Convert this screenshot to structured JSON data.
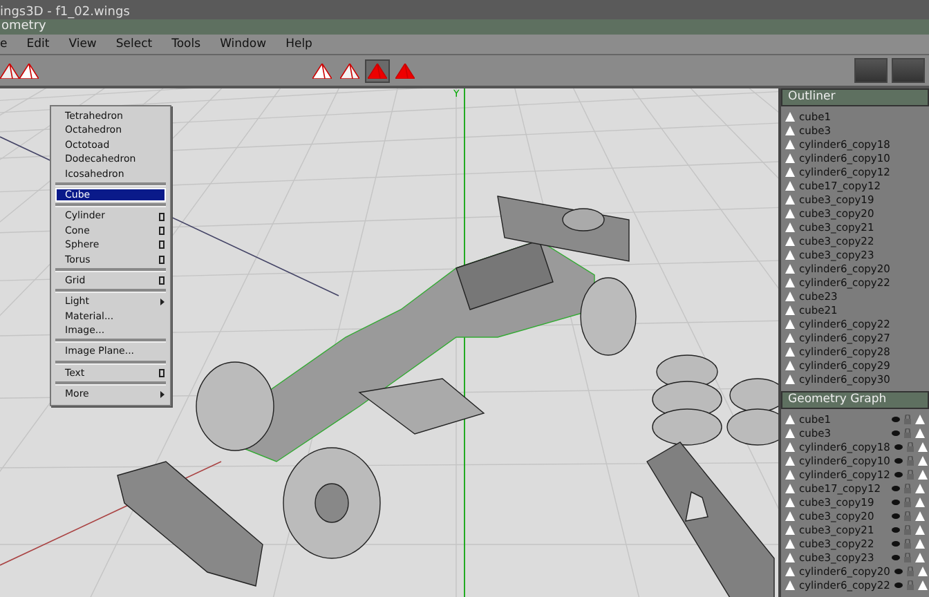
{
  "window": {
    "title": "ings3D - f1_02.wings"
  },
  "geometry_window": {
    "title": "ometry"
  },
  "menubar": [
    "e",
    "Edit",
    "View",
    "Select",
    "Tools",
    "Window",
    "Help"
  ],
  "selection_modes": [
    {
      "kind": "vertex",
      "selected": false
    },
    {
      "kind": "edge",
      "selected": false
    },
    {
      "kind": "face",
      "selected": true
    },
    {
      "kind": "body",
      "selected": false
    }
  ],
  "axis_label": "Y",
  "context_menu": {
    "items": [
      {
        "kind": "item",
        "label": "Tetrahedron",
        "selected": false
      },
      {
        "kind": "item",
        "label": "Octahedron",
        "selected": false
      },
      {
        "kind": "item",
        "label": "Octotoad",
        "selected": false
      },
      {
        "kind": "item",
        "label": "Dodecahedron",
        "selected": false
      },
      {
        "kind": "item",
        "label": "Icosahedron",
        "selected": false
      },
      {
        "kind": "separator"
      },
      {
        "kind": "item",
        "label": "Cube",
        "selected": true
      },
      {
        "kind": "separator"
      },
      {
        "kind": "option",
        "label": "Cylinder",
        "selected": false
      },
      {
        "kind": "option",
        "label": "Cone",
        "selected": false
      },
      {
        "kind": "option",
        "label": "Sphere",
        "selected": false
      },
      {
        "kind": "option",
        "label": "Torus",
        "selected": false
      },
      {
        "kind": "separator"
      },
      {
        "kind": "option",
        "label": "Grid",
        "selected": false
      },
      {
        "kind": "separator"
      },
      {
        "kind": "submenu",
        "label": "Light",
        "selected": false
      },
      {
        "kind": "item",
        "label": "Material...",
        "selected": false
      },
      {
        "kind": "item",
        "label": "Image...",
        "selected": false
      },
      {
        "kind": "separator"
      },
      {
        "kind": "item",
        "label": "Image Plane...",
        "selected": false
      },
      {
        "kind": "separator"
      },
      {
        "kind": "option",
        "label": "Text",
        "selected": false
      },
      {
        "kind": "separator"
      },
      {
        "kind": "submenu",
        "label": "More",
        "selected": false
      }
    ]
  },
  "outliner": {
    "title": "Outliner",
    "items": [
      "cube1",
      "cube3",
      "cylinder6_copy18",
      "cylinder6_copy10",
      "cylinder6_copy12",
      "cube17_copy12",
      "cube3_copy19",
      "cube3_copy20",
      "cube3_copy21",
      "cube3_copy22",
      "cube3_copy23",
      "cylinder6_copy20",
      "cylinder6_copy22",
      "cube23",
      "cube21",
      "cylinder6_copy22",
      "cylinder6_copy27",
      "cylinder6_copy28",
      "cylinder6_copy29",
      "cylinder6_copy30"
    ]
  },
  "geometry_graph": {
    "title": "Geometry Graph",
    "items": [
      "cube1",
      "cube3",
      "cylinder6_copy18",
      "cylinder6_copy10",
      "cylinder6_copy12",
      "cube17_copy12",
      "cube3_copy19",
      "cube3_copy20",
      "cube3_copy21",
      "cube3_copy22",
      "cube3_copy23",
      "cylinder6_copy20",
      "cylinder6_copy22"
    ]
  }
}
